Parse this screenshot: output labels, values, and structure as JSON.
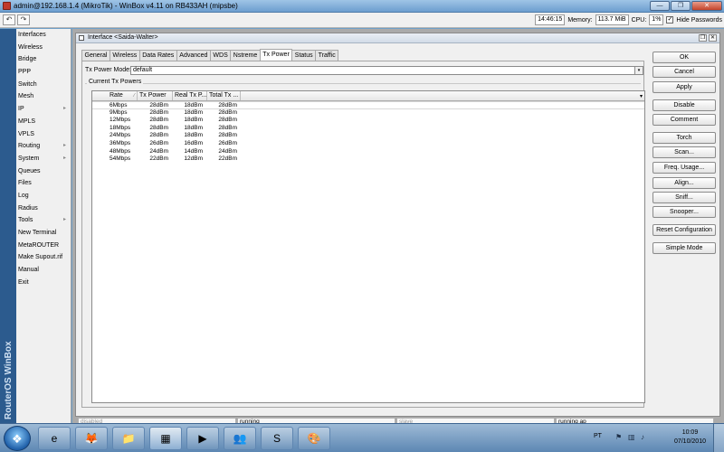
{
  "window": {
    "title": "admin@192.168.1.4 (MikroTik) - WinBox v4.11 on RB433AH (mipsbe)",
    "min_glyph": "—",
    "max_glyph": "❐",
    "close_glyph": "✕"
  },
  "toolbar": {
    "undo_glyph": "↶",
    "redo_glyph": "↷",
    "time": "14:46:15",
    "memory_label": "Memory:",
    "memory_value": "113.7 MiB",
    "cpu_label": "CPU:",
    "cpu_value": "1%",
    "hide_passwords_label": "Hide Passwords",
    "hide_passwords_checked": "✓"
  },
  "brand": "RouterOS WinBox",
  "menu": [
    {
      "label": "Interfaces",
      "sub": false
    },
    {
      "label": "Wireless",
      "sub": false
    },
    {
      "label": "Bridge",
      "sub": false
    },
    {
      "label": "PPP",
      "sub": false
    },
    {
      "label": "Switch",
      "sub": false
    },
    {
      "label": "Mesh",
      "sub": false
    },
    {
      "label": "IP",
      "sub": true
    },
    {
      "label": "MPLS",
      "sub": false
    },
    {
      "label": "VPLS",
      "sub": false
    },
    {
      "label": "Routing",
      "sub": true
    },
    {
      "label": "System",
      "sub": true
    },
    {
      "label": "Queues",
      "sub": false
    },
    {
      "label": "Files",
      "sub": false
    },
    {
      "label": "Log",
      "sub": false
    },
    {
      "label": "Radius",
      "sub": false
    },
    {
      "label": "Tools",
      "sub": true
    },
    {
      "label": "New Terminal",
      "sub": false
    },
    {
      "label": "MetaROUTER",
      "sub": false
    },
    {
      "label": "Make Supout.rif",
      "sub": false
    },
    {
      "label": "Manual",
      "sub": false
    },
    {
      "label": "Exit",
      "sub": false
    }
  ],
  "dialog": {
    "title": "Interface <Saida-Walter>",
    "restore_glyph": "❐",
    "close_glyph": "✕",
    "tabs": [
      "General",
      "Wireless",
      "Data Rates",
      "Advanced",
      "WDS",
      "Nstreme",
      "Tx Power",
      "Status",
      "Traffic"
    ],
    "active_tab": "Tx Power",
    "tx_power_mode_label": "Tx Power Mode:",
    "tx_power_mode_value": "default",
    "dropdown_glyph": "▾",
    "group_label": "Current Tx Powers",
    "columns": [
      "Rate",
      "Tx Power",
      "Real Tx P...",
      "Total Tx ..."
    ],
    "rows": [
      {
        "rate": "6Mbps",
        "tx_power": "28dBm",
        "real_tx": "18dBm",
        "total_tx": "28dBm"
      },
      {
        "rate": "9Mbps",
        "tx_power": "28dBm",
        "real_tx": "18dBm",
        "total_tx": "28dBm"
      },
      {
        "rate": "12Mbps",
        "tx_power": "28dBm",
        "real_tx": "18dBm",
        "total_tx": "28dBm"
      },
      {
        "rate": "18Mbps",
        "tx_power": "28dBm",
        "real_tx": "18dBm",
        "total_tx": "28dBm"
      },
      {
        "rate": "24Mbps",
        "tx_power": "28dBm",
        "real_tx": "18dBm",
        "total_tx": "28dBm"
      },
      {
        "rate": "36Mbps",
        "tx_power": "26dBm",
        "real_tx": "16dBm",
        "total_tx": "26dBm"
      },
      {
        "rate": "48Mbps",
        "tx_power": "24dBm",
        "real_tx": "14dBm",
        "total_tx": "24dBm"
      },
      {
        "rate": "54Mbps",
        "tx_power": "22dBm",
        "real_tx": "12dBm",
        "total_tx": "22dBm"
      }
    ],
    "buttons": [
      "OK",
      "Cancel",
      "Apply",
      "Disable",
      "Comment",
      "Torch",
      "Scan...",
      "Freq. Usage...",
      "Align...",
      "Sniff...",
      "Snooper...",
      "Reset Configuration",
      "Simple Mode"
    ],
    "status": [
      "disabled",
      "running",
      "slave",
      "running ap"
    ]
  },
  "taskbar": {
    "start_glyph": "❖",
    "apps": [
      {
        "name": "internet-explorer",
        "glyph": "e"
      },
      {
        "name": "firefox",
        "glyph": "🦊"
      },
      {
        "name": "file-explorer",
        "glyph": "📁"
      },
      {
        "name": "winbox",
        "glyph": "▦"
      },
      {
        "name": "media-player",
        "glyph": "▶"
      },
      {
        "name": "messenger",
        "glyph": "👥"
      },
      {
        "name": "skype",
        "glyph": "S"
      },
      {
        "name": "paint",
        "glyph": "🎨"
      }
    ],
    "language": "PT",
    "time": "10:09",
    "date": "07/10/2010"
  }
}
